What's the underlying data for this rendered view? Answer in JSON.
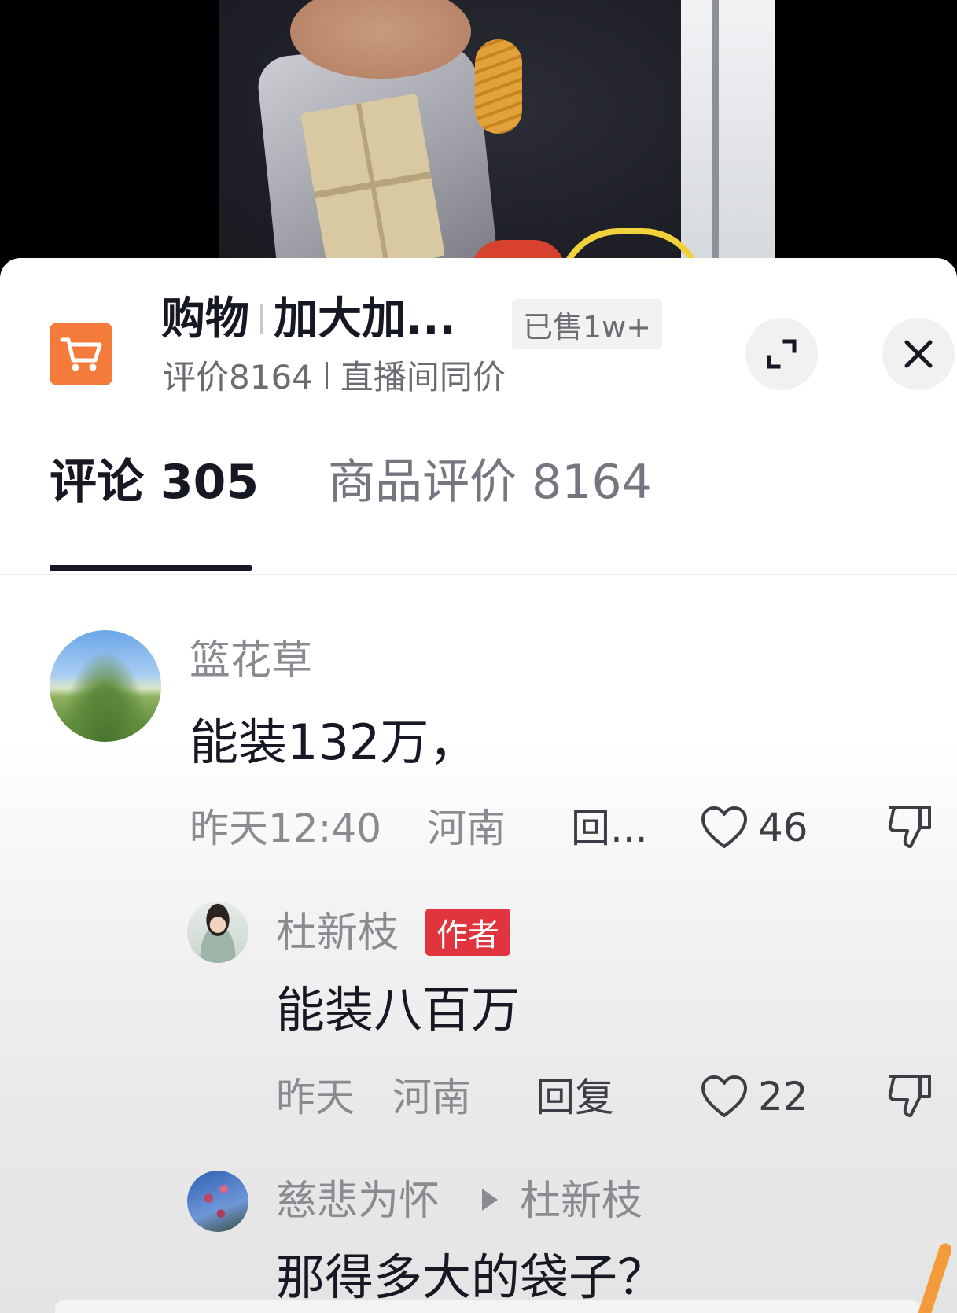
{
  "product": {
    "title_prefix": "购物",
    "title_name": "加大加...",
    "sold_tag": "已售1w+",
    "rating_label": "评价8164",
    "price_note": "直播间同价",
    "cart_icon": "shopping-cart-icon",
    "brand_color": "#f57b3b"
  },
  "tabs": [
    {
      "label": "评论 305",
      "active": true
    },
    {
      "label": "商品评价 8164",
      "active": false
    }
  ],
  "comments": [
    {
      "user": "篮花草",
      "text": "能装132万，",
      "time": "昨天12:40",
      "location": "河南",
      "reply_label": "回...",
      "likes": "46"
    }
  ],
  "replies": [
    {
      "user": "杜新枝",
      "badge": "作者",
      "text": "能装八百万",
      "time": "昨天",
      "location": "河南",
      "reply_label": "回复",
      "likes": "22"
    },
    {
      "user": "慈悲为怀",
      "reply_to": "杜新枝",
      "text": "那得多大的袋子？"
    }
  ],
  "colors": {
    "author_badge": "#e0353f",
    "text_primary": "#161823",
    "text_secondary": "#8a8b91"
  }
}
